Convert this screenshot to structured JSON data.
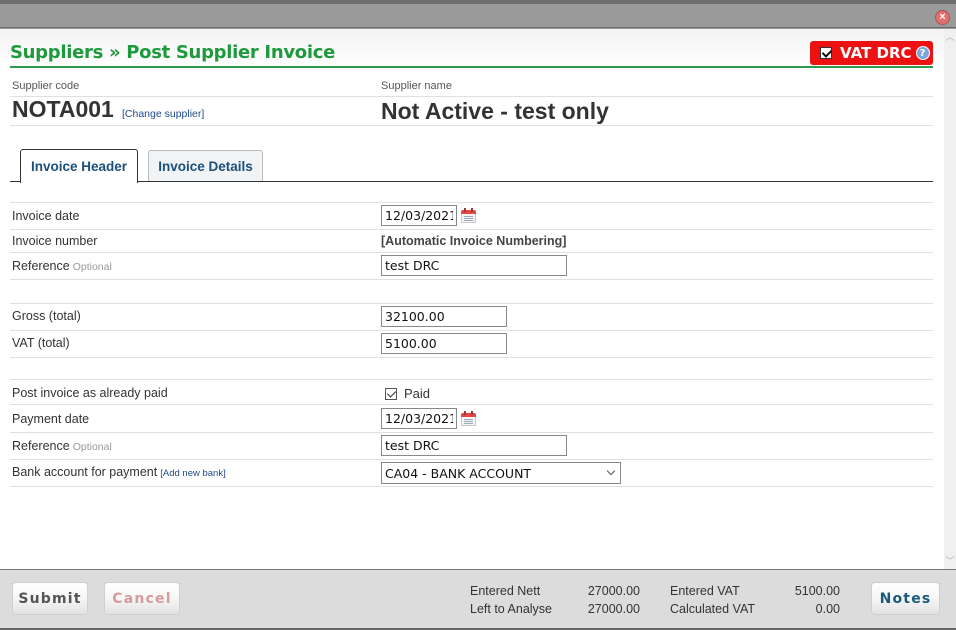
{
  "window": {
    "close_icon": "close-icon"
  },
  "header": {
    "title": "Suppliers » Post Supplier Invoice",
    "vat_drc": {
      "label": "VAT DRC",
      "checked": true,
      "help_icon": "?",
      "color": "#ee1111"
    }
  },
  "supplier": {
    "code_label": "Supplier code",
    "code": "NOTA001",
    "change_link": "[Change supplier]",
    "name_label": "Supplier name",
    "name": "Not Active - test only"
  },
  "tabs": [
    {
      "label": "Invoice Header",
      "active": true
    },
    {
      "label": "Invoice Details",
      "active": false
    }
  ],
  "invoice": {
    "date_label": "Invoice date",
    "date": "12/03/2021",
    "number_label": "Invoice number",
    "number": "[Automatic Invoice Numbering]",
    "reference_label": "Reference",
    "reference_optional": "Optional",
    "reference": "test DRC",
    "gross_label": "Gross (total)",
    "gross": "32100.00",
    "vat_label": "VAT (total)",
    "vat": "5100.00"
  },
  "payment": {
    "paid_label": "Post invoice as already paid",
    "paid_checkbox_label": "Paid",
    "paid": true,
    "date_label": "Payment date",
    "date": "12/03/2021",
    "reference_label": "Reference",
    "reference_optional": "Optional",
    "reference": "test DRC",
    "bank_label": "Bank account for payment",
    "add_bank_link": "[Add new bank]",
    "bank_selected": "CA04 - BANK ACCOUNT"
  },
  "footer": {
    "submit_label": "Submit",
    "cancel_label": "Cancel",
    "notes_label": "Notes",
    "entered_nett_label": "Entered Nett",
    "entered_nett": "27000.00",
    "left_to_analyse_label": "Left to Analyse",
    "left_to_analyse": "27000.00",
    "entered_vat_label": "Entered VAT",
    "entered_vat": "5100.00",
    "calculated_vat_label": "Calculated VAT",
    "calculated_vat": "0.00"
  }
}
